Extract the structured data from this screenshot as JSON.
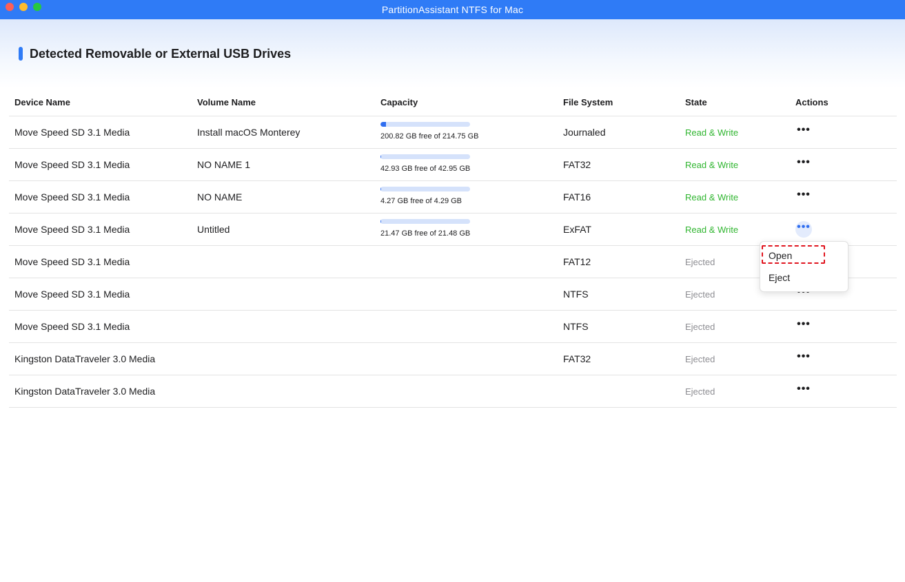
{
  "window": {
    "title": "PartitionAssistant NTFS for Mac"
  },
  "section": {
    "title": "Detected Removable or External USB Drives"
  },
  "table": {
    "headers": {
      "device": "Device Name",
      "volume": "Volume Name",
      "capacity": "Capacity",
      "filesystem": "File System",
      "state": "State",
      "actions": "Actions"
    },
    "rows": [
      {
        "device": "Move Speed SD 3.1 Media",
        "volume": "Install macOS Monterey",
        "capacity_text": "200.82 GB free of 214.75 GB",
        "used_fraction": 0.065,
        "filesystem": "Journaled",
        "state": "Read & Write"
      },
      {
        "device": "Move Speed SD 3.1 Media",
        "volume": "NO NAME 1",
        "capacity_text": "42.93 GB free of 42.95 GB",
        "used_fraction": 0.0005,
        "filesystem": "FAT32",
        "state": "Read & Write"
      },
      {
        "device": "Move Speed SD 3.1 Media",
        "volume": "NO NAME",
        "capacity_text": "4.27 GB free of 4.29 GB",
        "used_fraction": 0.005,
        "filesystem": "FAT16",
        "state": "Read & Write"
      },
      {
        "device": "Move Speed SD 3.1 Media",
        "volume": "Untitled",
        "capacity_text": "21.47 GB free of 21.48 GB",
        "used_fraction": 0.0005,
        "filesystem": "ExFAT",
        "state": "Read & Write"
      },
      {
        "device": "Move Speed SD 3.1 Media",
        "volume": "",
        "capacity_text": "",
        "filesystem": "FAT12",
        "state": "Ejected"
      },
      {
        "device": "Move Speed SD 3.1 Media",
        "volume": "",
        "capacity_text": "",
        "filesystem": "NTFS",
        "state": "Ejected"
      },
      {
        "device": "Move Speed SD 3.1 Media",
        "volume": "",
        "capacity_text": "",
        "filesystem": "NTFS",
        "state": "Ejected"
      },
      {
        "device": "Kingston DataTraveler 3.0 Media",
        "volume": "",
        "capacity_text": "",
        "filesystem": "FAT32",
        "state": "Ejected"
      },
      {
        "device": "Kingston DataTraveler 3.0 Media",
        "volume": "",
        "capacity_text": "",
        "filesystem": "",
        "state": "Ejected"
      }
    ]
  },
  "more_button": {
    "glyph": "•••"
  },
  "context_menu": {
    "open": "Open",
    "eject": "Eject"
  },
  "colors": {
    "accent": "#2f7bf6",
    "read_write": "#2fb52f",
    "ejected": "#8e8e93",
    "highlight": "#e0141e"
  }
}
